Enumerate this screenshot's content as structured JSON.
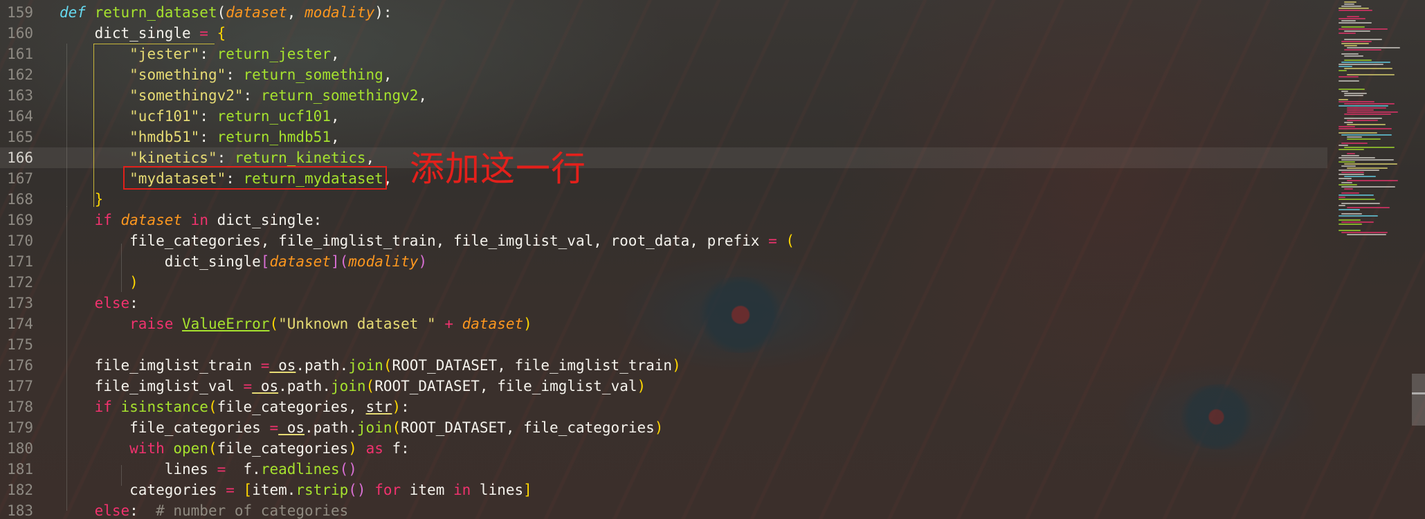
{
  "editor": {
    "current_line": "166",
    "lines": [
      {
        "n": "159",
        "tokens": [
          [
            "kw-it",
            "def "
          ],
          [
            "fn",
            "return_dataset"
          ],
          [
            "",
            "("
          ],
          [
            "prm",
            "dataset"
          ],
          [
            "",
            ", "
          ],
          [
            "prm",
            "modality"
          ],
          [
            "",
            "):"
          ]
        ]
      },
      {
        "n": "160",
        "tokens": [
          [
            "",
            "    dict_single "
          ],
          [
            "op",
            "="
          ],
          [
            "",
            ""
          ],
          [
            "br1",
            " {"
          ]
        ]
      },
      {
        "n": "161",
        "tokens": [
          [
            "",
            "        "
          ],
          [
            "str",
            "\"jester\""
          ],
          [
            "",
            ": "
          ],
          [
            "fn",
            "return_jester"
          ],
          [
            "",
            ","
          ]
        ]
      },
      {
        "n": "162",
        "tokens": [
          [
            "",
            "        "
          ],
          [
            "str",
            "\"something\""
          ],
          [
            "",
            ": "
          ],
          [
            "fn",
            "return_something"
          ],
          [
            "",
            ","
          ]
        ]
      },
      {
        "n": "163",
        "tokens": [
          [
            "",
            "        "
          ],
          [
            "str",
            "\"somethingv2\""
          ],
          [
            "",
            ": "
          ],
          [
            "fn",
            "return_somethingv2"
          ],
          [
            "",
            ","
          ]
        ]
      },
      {
        "n": "164",
        "tokens": [
          [
            "",
            "        "
          ],
          [
            "str",
            "\"ucf101\""
          ],
          [
            "",
            ": "
          ],
          [
            "fn",
            "return_ucf101"
          ],
          [
            "",
            ","
          ]
        ]
      },
      {
        "n": "165",
        "tokens": [
          [
            "",
            "        "
          ],
          [
            "str",
            "\"hmdb51\""
          ],
          [
            "",
            ": "
          ],
          [
            "fn",
            "return_hmdb51"
          ],
          [
            "",
            ","
          ]
        ]
      },
      {
        "n": "166",
        "tokens": [
          [
            "",
            "        "
          ],
          [
            "str",
            "\"kinetics\""
          ],
          [
            "",
            ": "
          ],
          [
            "fn",
            "return_kinetics"
          ],
          [
            "",
            ","
          ]
        ]
      },
      {
        "n": "167",
        "tokens": [
          [
            "",
            "        "
          ],
          [
            "str",
            "\"mydataset\""
          ],
          [
            "",
            ": "
          ],
          [
            "fn",
            "return_mydataset"
          ],
          [
            "",
            ","
          ]
        ]
      },
      {
        "n": "168",
        "tokens": [
          [
            "",
            "    "
          ],
          [
            "br1",
            "}"
          ]
        ]
      },
      {
        "n": "169",
        "tokens": [
          [
            "",
            "    "
          ],
          [
            "kw",
            "if "
          ],
          [
            "prm",
            "dataset"
          ],
          [
            "kw",
            " in "
          ],
          [
            "",
            "dict_single:"
          ]
        ]
      },
      {
        "n": "170",
        "tokens": [
          [
            "",
            "        file_categories, file_imglist_train, file_imglist_val, root_data, prefix "
          ],
          [
            "op",
            "="
          ],
          [
            "br1",
            " ("
          ]
        ]
      },
      {
        "n": "171",
        "tokens": [
          [
            "",
            "            dict_single"
          ],
          [
            "br2",
            "["
          ],
          [
            "prm",
            "dataset"
          ],
          [
            "br2",
            "]"
          ],
          [
            "br2",
            "("
          ],
          [
            "prm",
            "modality"
          ],
          [
            "br2",
            ")"
          ]
        ]
      },
      {
        "n": "172",
        "tokens": [
          [
            "",
            "        "
          ],
          [
            "br1",
            ")"
          ]
        ]
      },
      {
        "n": "173",
        "tokens": [
          [
            "",
            "    "
          ],
          [
            "kw",
            "else"
          ],
          [
            "",
            ":"
          ]
        ]
      },
      {
        "n": "174",
        "tokens": [
          [
            "",
            "        "
          ],
          [
            "kw",
            "raise "
          ],
          [
            "cls",
            "ValueError"
          ],
          [
            "br1",
            "("
          ],
          [
            "str",
            "\"Unknown dataset \""
          ],
          [
            "op",
            " + "
          ],
          [
            "prm",
            "dataset"
          ],
          [
            "br1",
            ")"
          ]
        ]
      },
      {
        "n": "175",
        "tokens": [
          [
            "",
            ""
          ]
        ]
      },
      {
        "n": "176",
        "tokens": [
          [
            "",
            "    file_imglist_train "
          ],
          [
            "op",
            "="
          ],
          [
            "",
            ""
          ],
          [
            "uline",
            " os"
          ],
          [
            "",
            ".path."
          ],
          [
            "fn",
            "join"
          ],
          [
            "br1",
            "("
          ],
          [
            "",
            "ROOT_DATASET, file_imglist_train"
          ],
          [
            "br1",
            ")"
          ]
        ]
      },
      {
        "n": "177",
        "tokens": [
          [
            "",
            "    file_imglist_val "
          ],
          [
            "op",
            "="
          ],
          [
            "uline",
            " os"
          ],
          [
            "",
            ".path."
          ],
          [
            "fn",
            "join"
          ],
          [
            "br1",
            "("
          ],
          [
            "",
            "ROOT_DATASET, file_imglist_val"
          ],
          [
            "br1",
            ")"
          ]
        ]
      },
      {
        "n": "178",
        "tokens": [
          [
            "",
            "    "
          ],
          [
            "kw",
            "if "
          ],
          [
            "fn",
            "isinstance"
          ],
          [
            "br1",
            "("
          ],
          [
            "",
            "file_categories, "
          ],
          [
            "uline",
            "str"
          ],
          [
            "br1",
            ")"
          ],
          [
            "",
            ":"
          ]
        ]
      },
      {
        "n": "179",
        "tokens": [
          [
            "",
            "        file_categories "
          ],
          [
            "op",
            "="
          ],
          [
            "uline",
            " os"
          ],
          [
            "",
            ".path."
          ],
          [
            "fn",
            "join"
          ],
          [
            "br1",
            "("
          ],
          [
            "",
            "ROOT_DATASET, file_categories"
          ],
          [
            "br1",
            ")"
          ]
        ]
      },
      {
        "n": "180",
        "tokens": [
          [
            "",
            "        "
          ],
          [
            "kw",
            "with "
          ],
          [
            "fn",
            "open"
          ],
          [
            "br1",
            "("
          ],
          [
            "",
            "file_categories"
          ],
          [
            "br1",
            ")"
          ],
          [
            "kw",
            " as "
          ],
          [
            "",
            "f:"
          ]
        ]
      },
      {
        "n": "181",
        "tokens": [
          [
            "",
            "            lines "
          ],
          [
            "op",
            "="
          ],
          [
            "",
            ""
          ],
          [
            "",
            ""
          ],
          [
            "",
            "  f."
          ],
          [
            "fn",
            "readlines"
          ],
          [
            "br2",
            "()"
          ]
        ]
      },
      {
        "n": "182",
        "tokens": [
          [
            "",
            "        categories "
          ],
          [
            "op",
            "="
          ],
          [
            "br1",
            " ["
          ],
          [
            "",
            "item."
          ],
          [
            "fn",
            "rstrip"
          ],
          [
            "br2",
            "()"
          ],
          [
            "kw",
            " for "
          ],
          [
            "",
            "item"
          ],
          [
            "kw",
            " in "
          ],
          [
            "",
            "lines"
          ],
          [
            "br1",
            "]"
          ]
        ]
      },
      {
        "n": "183",
        "tokens": [
          [
            "",
            "    "
          ],
          [
            "kw",
            "else"
          ],
          [
            "",
            ":  "
          ],
          [
            "cm",
            "# number of categories"
          ]
        ]
      }
    ]
  },
  "annotation": {
    "text": "添加这一行",
    "color": "#e3201b"
  },
  "colors": {
    "keyword": "#f0326e",
    "function": "#a6e22e",
    "string": "#e6db74",
    "param": "#fd971f",
    "builtin": "#66d9ef"
  }
}
